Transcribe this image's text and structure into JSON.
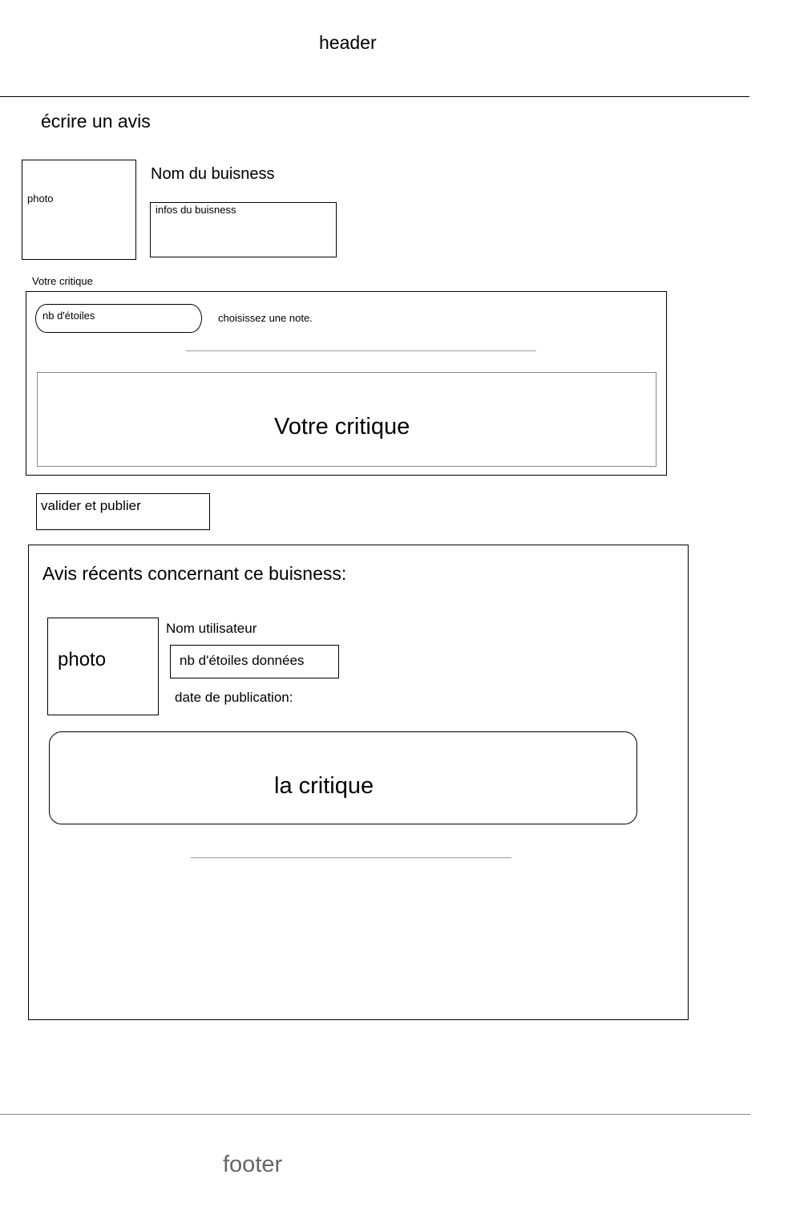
{
  "header": {
    "label": "header"
  },
  "page": {
    "title": "écrire un avis"
  },
  "business": {
    "photo_label": "photo",
    "name": "Nom du buisness",
    "info_label": "infos  du buisness"
  },
  "review_form": {
    "section_label": "Votre critique",
    "star_select_label": "nb d'étoiles",
    "rating_hint": "choisissez une note.",
    "textarea_placeholder": "Votre critique"
  },
  "submit": {
    "label": "valider et publier"
  },
  "recent_reviews": {
    "title": "Avis récents concernant ce buisness:",
    "review": {
      "photo_label": "photo",
      "user_name": "Nom utilisateur",
      "stars_given": "nb d'étoiles données",
      "date_label": "date de publication:",
      "body": "la critique"
    }
  },
  "footer": {
    "label": "footer"
  }
}
